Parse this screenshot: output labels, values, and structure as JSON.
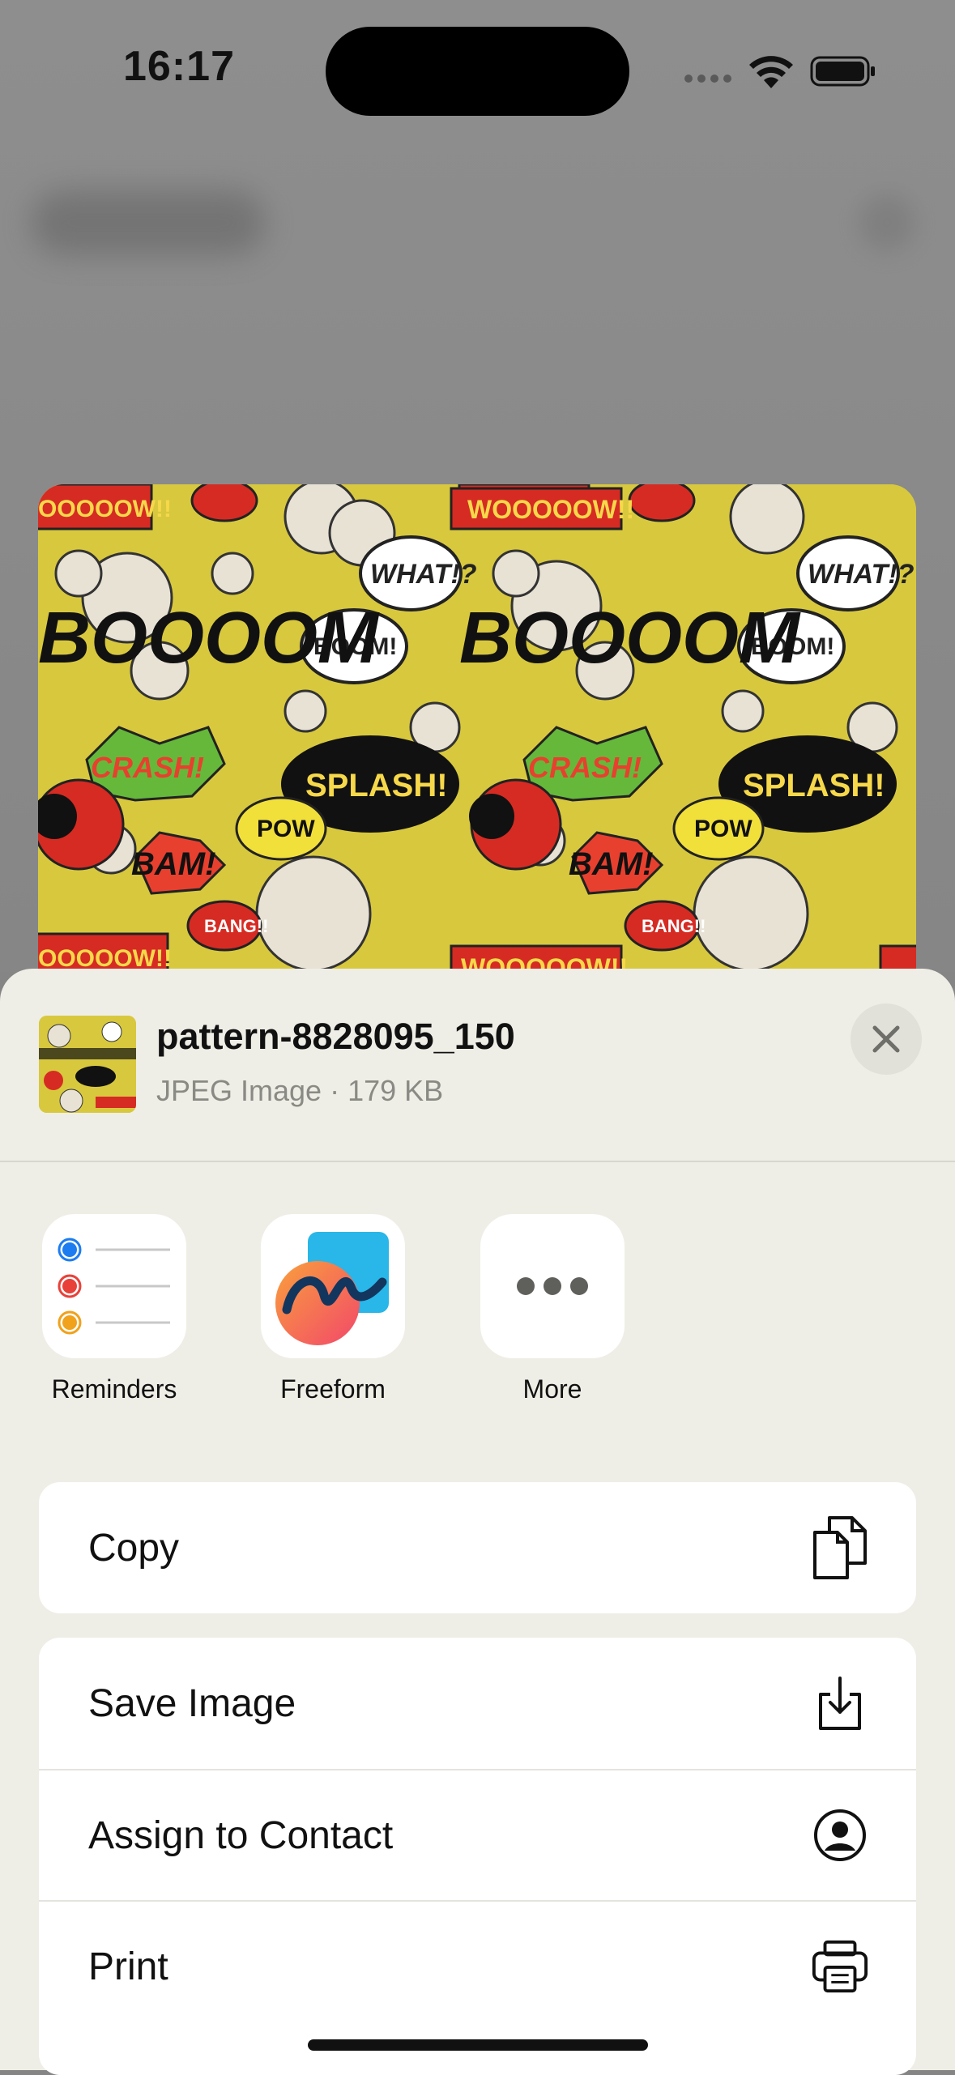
{
  "status_bar": {
    "time": "16:17"
  },
  "file": {
    "name": "pattern-8828095_150",
    "meta": "JPEG Image · 179 KB"
  },
  "apps": [
    {
      "label": "Reminders",
      "icon": "reminders-icon"
    },
    {
      "label": "Freeform",
      "icon": "freeform-icon"
    },
    {
      "label": "More",
      "icon": "more-icon"
    }
  ],
  "actions": {
    "copy": {
      "label": "Copy",
      "icon": "copy-icon"
    },
    "save_image": {
      "label": "Save Image",
      "icon": "download-icon"
    },
    "assign_contact": {
      "label": "Assign to Contact",
      "icon": "contact-icon"
    },
    "print": {
      "label": "Print",
      "icon": "printer-icon"
    }
  },
  "colors": {
    "sheet_bg": "#efeee6",
    "pattern_yellow": "#d8c83e",
    "reminder_blue": "#1c7cf0",
    "reminder_red": "#e8413a",
    "reminder_orange": "#f0a21c"
  }
}
